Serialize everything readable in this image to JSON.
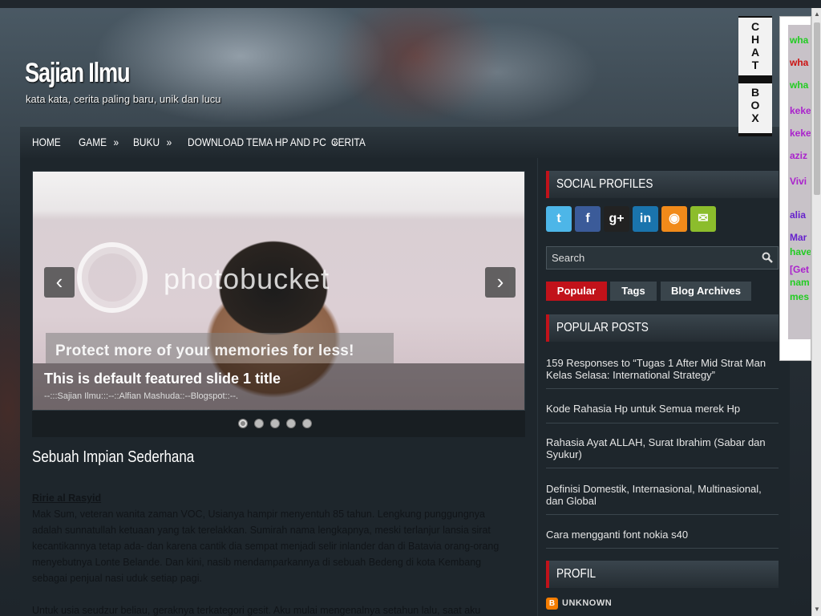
{
  "site": {
    "title": "Sajian Ilmu",
    "description": "kata kata, cerita paling baru, unik dan lucu"
  },
  "nav": {
    "items": [
      {
        "label": "HOME",
        "arrow": ""
      },
      {
        "label": "GAME",
        "arrow": "»"
      },
      {
        "label": "BUKU",
        "arrow": "»"
      },
      {
        "label": "DOWNLOAD TEMA HP AND PC",
        "arrow": "»"
      },
      {
        "label": "CERITA",
        "arrow": ""
      }
    ]
  },
  "slider": {
    "prev_label": "‹",
    "next_label": "›",
    "slide_title": "This is default featured slide 1 title",
    "slide_text": "--:::Sajian Ilmu:::--::Alfian Mashuda::--Blogspot::--.",
    "watermark": "photobucket",
    "watermark_banner": "Protect more of your memories for less!",
    "dots_count": 5,
    "active_dot": 1
  },
  "post": {
    "title": "Sebuah Impian Sederhana",
    "author": "Ririe al Rasyid",
    "paragraph1": "Mak Sum, veteran wanita zaman VOC, Usianya hampir menyentuh 85 tahun. Lengkung punggungnya adalah sunnatullah ketuaan yang tak terelakkan. Sumirah nama lengkapnya, meski terlanjur lansia sirat kecantikannya tetap ada- dan karena cantik dia sempat menjadi selir inlander dan di Batavia orang-orang menyebutnya Lonte Belande. Dan kini, nasib mendamparkannya di sebuah Bedeng di kota Kembang sebagai penjual nasi uduk setiap pagi.",
    "paragraph2": "Untuk usia seudzur beliau, geraknya terkategori gesit. Aku mulai mengenalnya setahun lalu, saat aku"
  },
  "sidebar": {
    "social_title": "SOCIAL PROFILES",
    "social_icons": [
      {
        "name": "twitter-icon",
        "glyph": "t",
        "color": "#4db6e8"
      },
      {
        "name": "facebook-icon",
        "glyph": "f",
        "color": "#3b5b99"
      },
      {
        "name": "google-plus-icon",
        "glyph": "g+",
        "color": "#222222"
      },
      {
        "name": "linkedin-icon",
        "glyph": "in",
        "color": "#1a74ad"
      },
      {
        "name": "rss-icon",
        "glyph": "◉",
        "color": "#f18a1a"
      },
      {
        "name": "email-icon",
        "glyph": "✉",
        "color": "#8cbd2c"
      }
    ],
    "search_placeholder": "Search",
    "tabs": [
      "Popular",
      "Tags",
      "Blog Archives"
    ],
    "popular_title": "POPULAR POSTS",
    "popular_posts": [
      "159 Responses to “Tugas 1 After Mid Strat Man Kelas Selasa: International Strategy”",
      "Kode Rahasia Hp untuk Semua merek Hp",
      "Rahasia Ayat ALLAH, Surat Ibrahim (Sabar dan Syukur)",
      "Definisi Domestik, Internasional, Multinasional, dan Global",
      "Cara mengganti font nokia s40"
    ],
    "profile_title": "PROFIL",
    "profile_name": "UNKNOWN"
  },
  "chatbox": {
    "label_top": "C H A T",
    "label_bottom": "B O X",
    "lines": [
      {
        "text": "wha",
        "color": "#22cc22"
      },
      {
        "text": "wha",
        "color": "#cc1111"
      },
      {
        "text": "wha",
        "color": "#22cc22"
      },
      {
        "text": "keke",
        "color": "#aa22cc"
      },
      {
        "text": "keke",
        "color": "#aa22cc"
      },
      {
        "text": "aziz",
        "color": "#aa22cc"
      },
      {
        "text": "Vivi",
        "color": "#aa22cc"
      },
      {
        "text": "alia",
        "color": "#6622cc"
      },
      {
        "text": "Mar",
        "color": "#6622cc"
      },
      {
        "text": "have",
        "color": "#22cc22"
      },
      {
        "text": "[Get",
        "color": "#aa22cc"
      },
      {
        "text": "nam",
        "color": "#22cc22"
      },
      {
        "text": "mes",
        "color": "#22cc22"
      }
    ]
  }
}
